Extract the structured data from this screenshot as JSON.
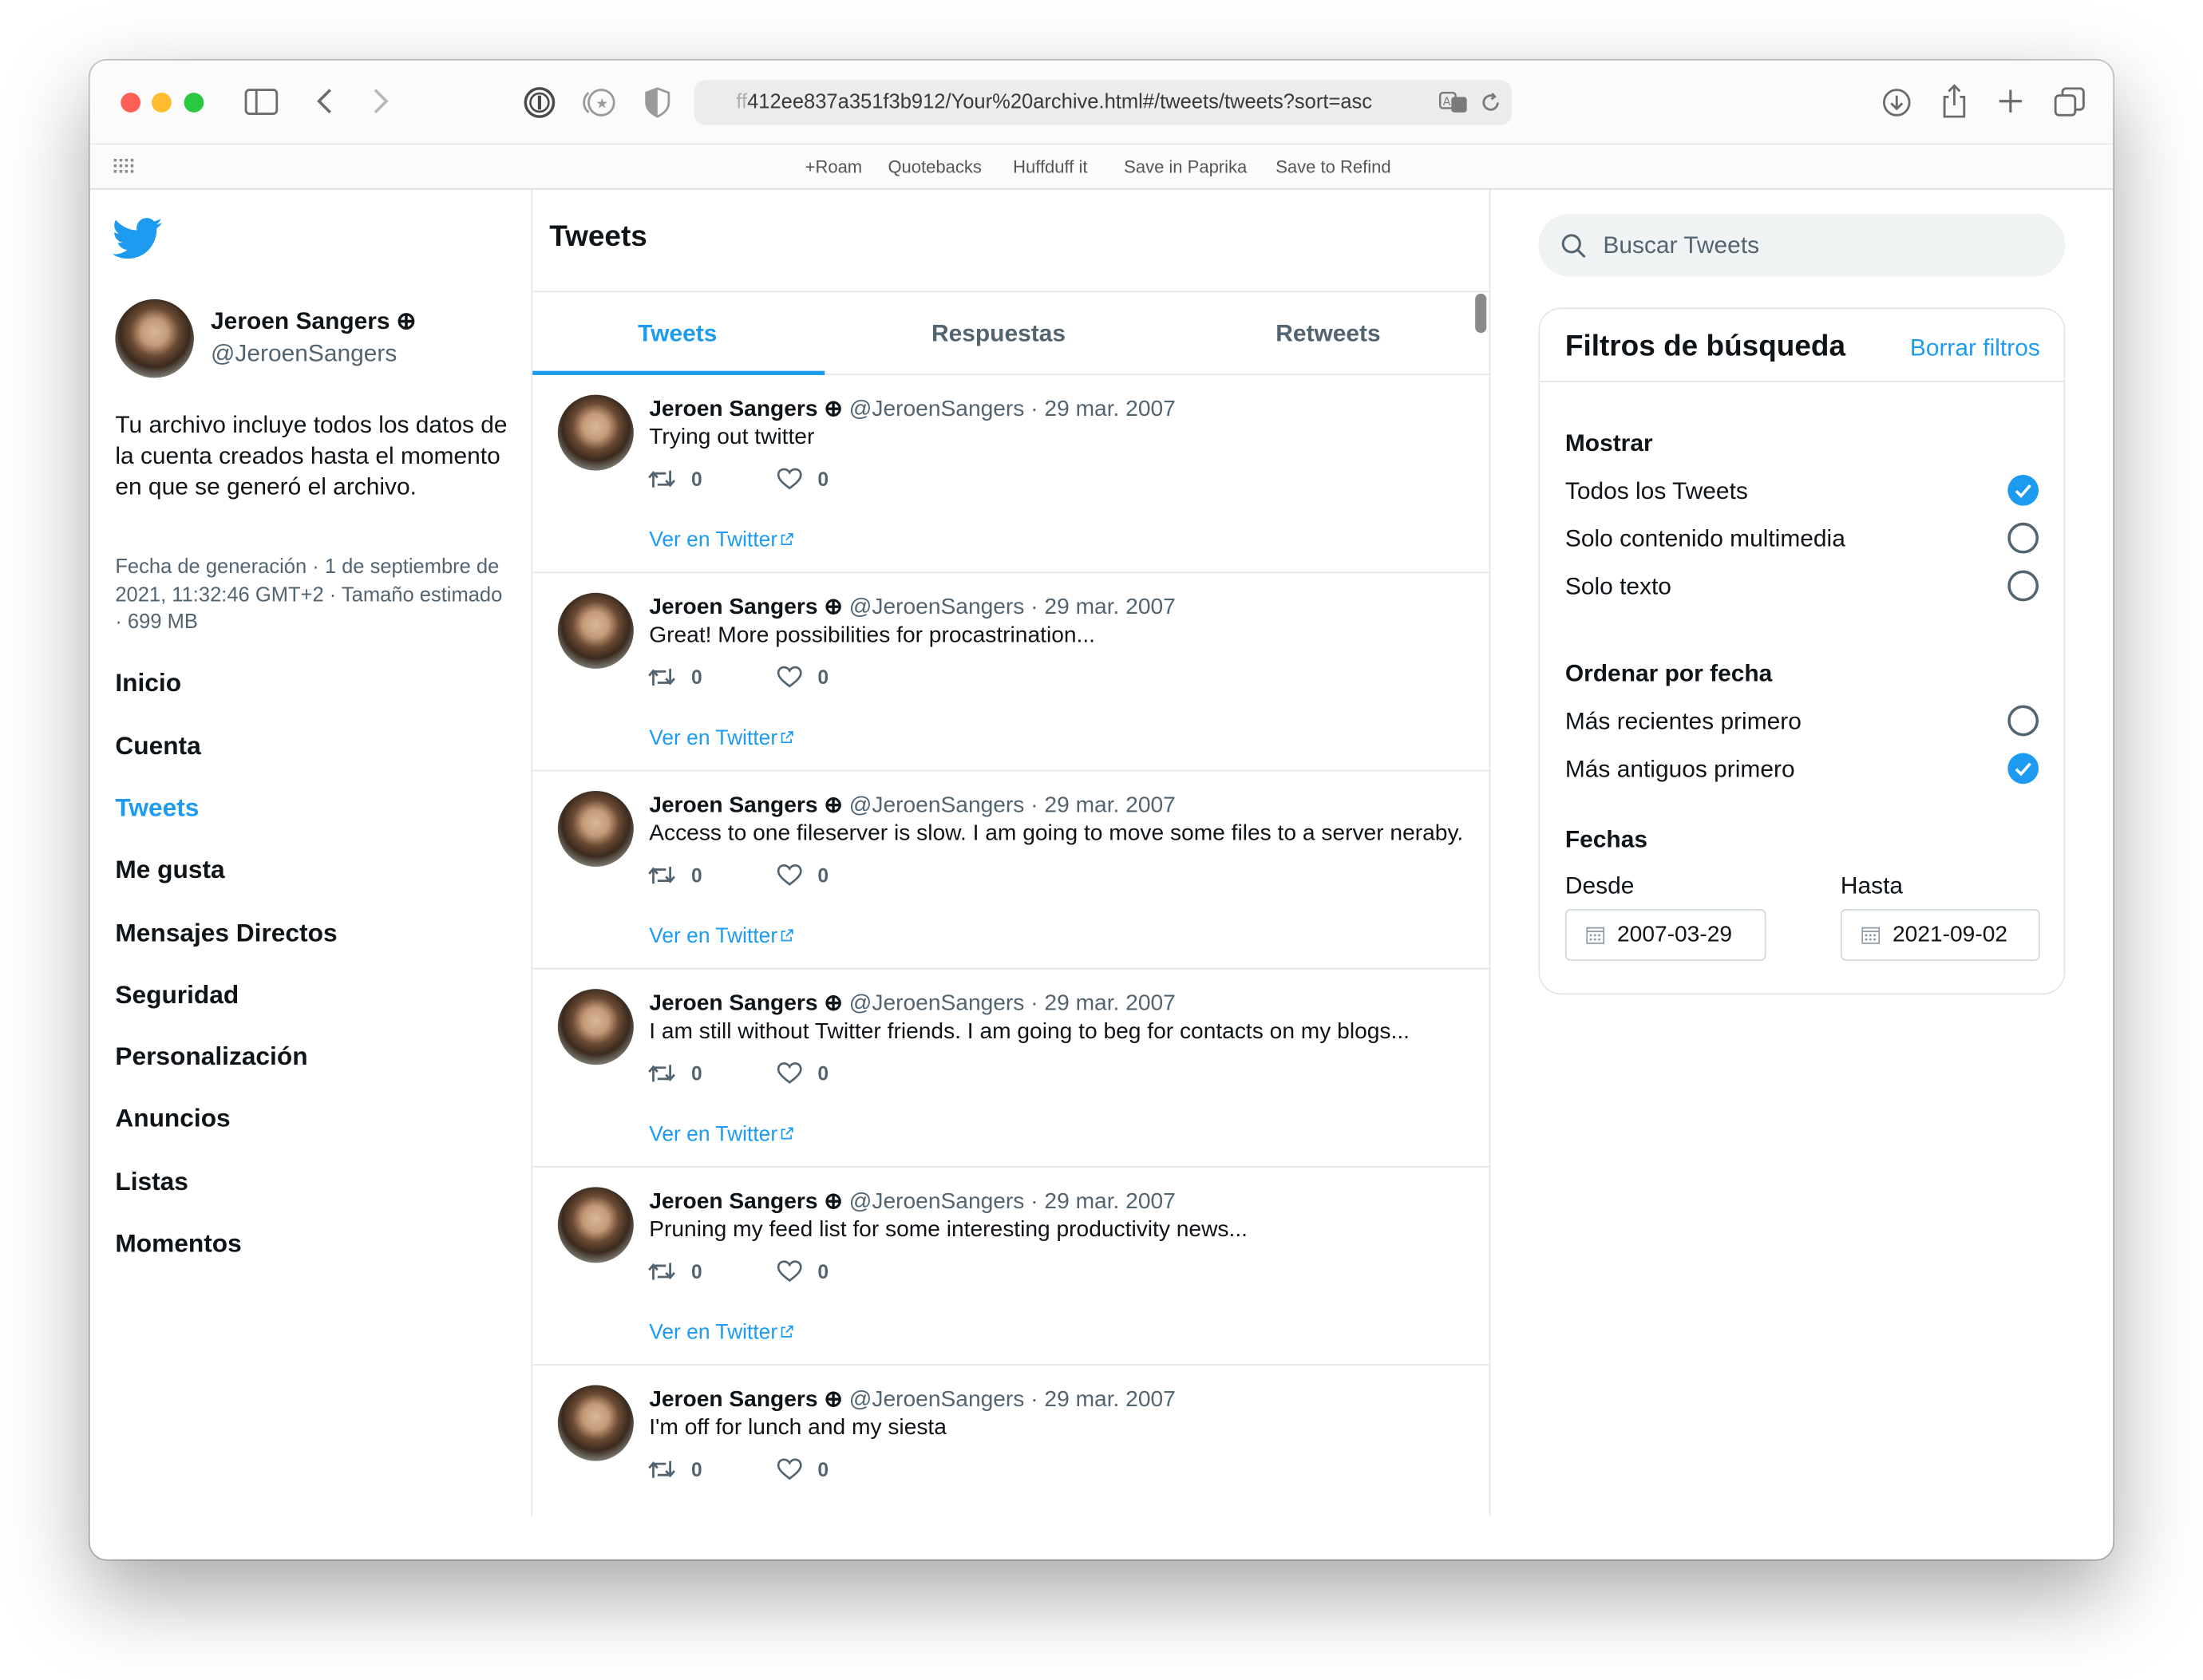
{
  "browser": {
    "url_faded": "ff",
    "url": "412ee837a351f3b912/Your%20archive.html#/tweets/tweets?sort=asc",
    "favorites": [
      "+Roam",
      "Quotebacks",
      "Huffduff it",
      "Save in Paprika",
      "Save to Refind"
    ]
  },
  "profile": {
    "name": "Jeroen Sangers",
    "name_badge": "⊕",
    "handle": "@JeroenSangers",
    "description": "Tu archivo incluye todos los datos de la cuenta creados hasta el momento en que se generó el archivo.",
    "meta": "Fecha de generación · 1 de septiembre de 2021, 11:32:46 GMT+2 · Tamaño estimado · 699 MB"
  },
  "nav": {
    "items": [
      "Inicio",
      "Cuenta",
      "Tweets",
      "Me gusta",
      "Mensajes Directos",
      "Seguridad",
      "Personalización",
      "Anuncios",
      "Listas",
      "Momentos"
    ],
    "active": "Tweets"
  },
  "main": {
    "title": "Tweets",
    "tabs": [
      "Tweets",
      "Respuestas",
      "Retweets"
    ],
    "active_tab": "Tweets",
    "view_label": "Ver en Twitter",
    "tweets": [
      {
        "name": "Jeroen Sangers ⊕",
        "meta": "@JeroenSangers · 29 mar. 2007",
        "text": "Trying out twitter",
        "retweets": "0",
        "likes": "0"
      },
      {
        "name": "Jeroen Sangers ⊕",
        "meta": "@JeroenSangers · 29 mar. 2007",
        "text": "Great! More possibilities for procastrination...",
        "retweets": "0",
        "likes": "0"
      },
      {
        "name": "Jeroen Sangers ⊕",
        "meta": "@JeroenSangers · 29 mar. 2007",
        "text": "Access to one fileserver is slow. I am going to move some files to a server neraby.",
        "retweets": "0",
        "likes": "0"
      },
      {
        "name": "Jeroen Sangers ⊕",
        "meta": "@JeroenSangers · 29 mar. 2007",
        "text": "I am still without Twitter friends. I am going to beg for contacts on my blogs...",
        "retweets": "0",
        "likes": "0"
      },
      {
        "name": "Jeroen Sangers ⊕",
        "meta": "@JeroenSangers · 29 mar. 2007",
        "text": "Pruning my feed list for some interesting productivity news...",
        "retweets": "0",
        "likes": "0"
      },
      {
        "name": "Jeroen Sangers ⊕",
        "meta": "@JeroenSangers · 29 mar. 2007",
        "text": "I'm off for lunch and my siesta",
        "retweets": "0",
        "likes": "0"
      }
    ]
  },
  "search": {
    "placeholder": "Buscar Tweets"
  },
  "filters": {
    "title": "Filtros de búsqueda",
    "clear": "Borrar filtros",
    "show_heading": "Mostrar",
    "show_options": [
      {
        "label": "Todos los Tweets",
        "checked": true
      },
      {
        "label": "Solo contenido multimedia",
        "checked": false
      },
      {
        "label": "Solo texto",
        "checked": false
      }
    ],
    "order_heading": "Ordenar por fecha",
    "order_options": [
      {
        "label": "Más recientes primero",
        "checked": false
      },
      {
        "label": "Más antiguos primero",
        "checked": true
      }
    ],
    "dates_heading": "Fechas",
    "from_label": "Desde",
    "to_label": "Hasta",
    "from_value": "2007-03-29",
    "to_value": "2021-09-02"
  },
  "colors": {
    "accent": "#1d9bf0",
    "text": "#0f1419",
    "muted": "#536471"
  }
}
